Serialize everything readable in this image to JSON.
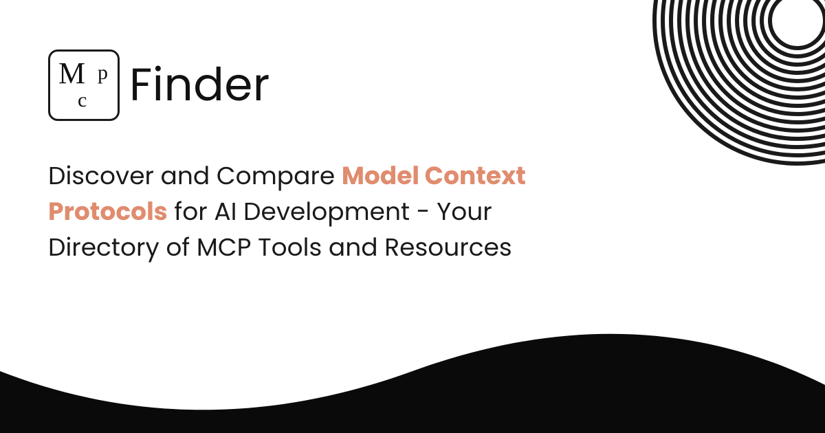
{
  "logo": {
    "letter_m": "M",
    "letter_c": "c",
    "letter_p": "p",
    "word": "Finder"
  },
  "headline": {
    "pre": "Discover and Compare ",
    "accent": "Model Context Protocols",
    "post": " for AI Development - Your Directory of MCP Tools and Resources"
  },
  "colors": {
    "accent": "#E08C6E",
    "ink": "#1a1a1a"
  }
}
